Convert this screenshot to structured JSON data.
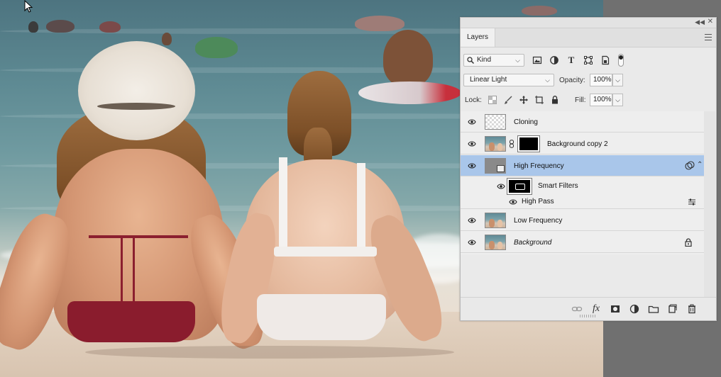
{
  "panel": {
    "tab_label": "Layers",
    "filter": {
      "kind_label": "Kind",
      "icons": [
        "image-filter-icon",
        "adjustment-filter-icon",
        "type-filter-icon",
        "shape-filter-icon",
        "smart-object-filter-icon",
        "filter-toggle-icon"
      ]
    },
    "blend_mode": "Linear Light",
    "opacity_label": "Opacity:",
    "opacity_value": "100%",
    "lock_label": "Lock:",
    "fill_label": "Fill:",
    "fill_value": "100%",
    "layers": [
      {
        "name": "Cloning",
        "visible": true
      },
      {
        "name": "Background copy 2",
        "visible": true
      },
      {
        "name": "High Frequency",
        "visible": true,
        "selected": true
      },
      {
        "name": "Smart Filters",
        "visible": true
      },
      {
        "name": "High Pass",
        "visible": true
      },
      {
        "name": "Low Frequency",
        "visible": true
      },
      {
        "name": "Background",
        "visible": true,
        "locked": true
      }
    ],
    "bottom_icons": [
      "link-layers-icon",
      "fx-icon",
      "add-mask-icon",
      "new-adjustment-icon",
      "new-group-icon",
      "new-layer-icon",
      "delete-icon"
    ],
    "fx_label": "fx"
  },
  "colors": {
    "selection": "#a9c6ea",
    "panel_bg": "#eaeaea"
  }
}
